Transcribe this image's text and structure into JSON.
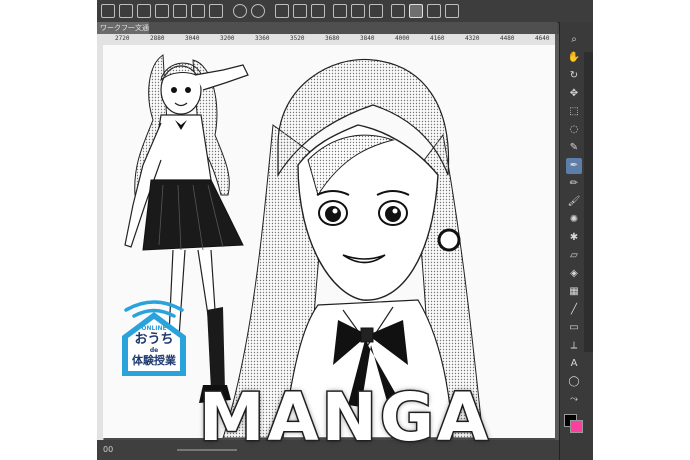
{
  "app": {
    "document_tab": "ワークフ一文通",
    "ruler_marks": [
      "2720",
      "2880",
      "3040",
      "3200",
      "3360",
      "3520",
      "3680",
      "3840",
      "4000",
      "4160",
      "4320",
      "4480",
      "4640"
    ],
    "status_text": "00"
  },
  "toolbar": {
    "icons": [
      "new-canvas-icon",
      "open-icon",
      "save-icon",
      "export-icon",
      "print-icon",
      "undo-icon",
      "redo-icon",
      "transform-icon",
      "fill-icon",
      "lasso-icon",
      "snap-icon",
      "pen-icon",
      "brush-icon",
      "eraser-icon"
    ]
  },
  "tools": [
    "zoom",
    "pan",
    "rotate",
    "move",
    "select",
    "lasso",
    "eyedropper",
    "pen",
    "pencil",
    "brush",
    "airbrush",
    "decorate",
    "eraser",
    "fill",
    "gradient",
    "shape",
    "frame",
    "ruler",
    "text",
    "balloon",
    "correct"
  ],
  "badge": {
    "online": "ONLINE",
    "line1": "おうち",
    "de": "de",
    "line2": "体験授業"
  },
  "title": "MANGA",
  "colors": {
    "app_bg": "#4a4a4a",
    "accent": "#5c7ea8",
    "badge_blue": "#2aa3dc",
    "badge_navy": "#1e3a6e",
    "fg_swatch": "#000000",
    "bg_swatch": "#ff3fa0"
  }
}
